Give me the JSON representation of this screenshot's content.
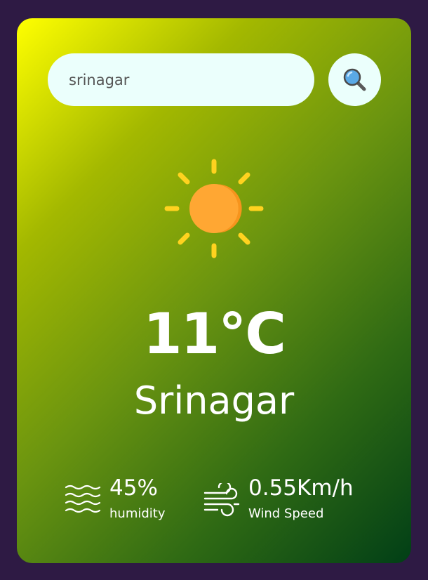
{
  "search": {
    "value": "srinagar",
    "icon": "magnifier-icon"
  },
  "weather": {
    "icon": "sun-icon",
    "temperature": "11°C",
    "city": "Srinagar"
  },
  "details": {
    "humidity": {
      "value": "45%",
      "label": "humidity",
      "icon": "humidity-waves-icon"
    },
    "wind": {
      "value": "0.55Km/h",
      "label": "Wind Speed",
      "icon": "wind-icon"
    }
  },
  "colors": {
    "page_background": "#2e1a44",
    "gradient_start": "#ffff00",
    "gradient_end": "#013f16",
    "input_background": "#ebfffc",
    "sun_core": "#ffa733",
    "sun_rays": "#ffd21f"
  }
}
